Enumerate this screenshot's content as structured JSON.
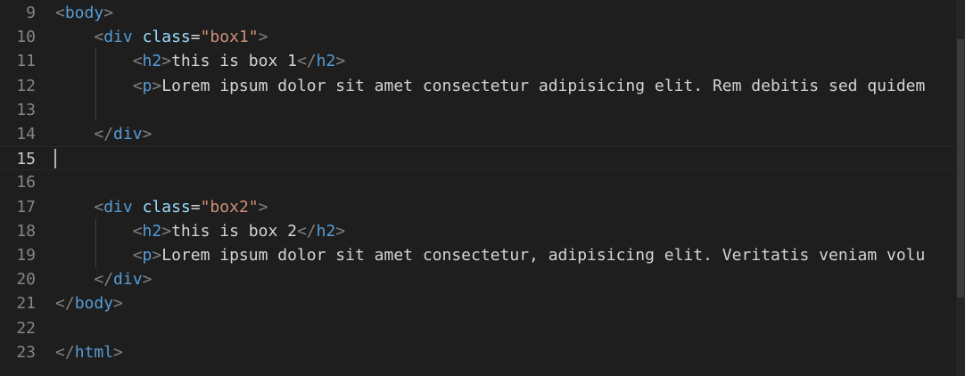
{
  "editor": {
    "lines": [
      {
        "num": "9",
        "indent": "",
        "tokens": [
          [
            "bracket",
            "<"
          ],
          [
            "tag",
            "body"
          ],
          [
            "bracket",
            ">"
          ]
        ]
      },
      {
        "num": "10",
        "indent": "    ",
        "tokens": [
          [
            "bracket",
            "<"
          ],
          [
            "tag",
            "div"
          ],
          [
            "text",
            " "
          ],
          [
            "attr",
            "class"
          ],
          [
            "text",
            "="
          ],
          [
            "str",
            "\"box1\""
          ],
          [
            "bracket",
            ">"
          ]
        ]
      },
      {
        "num": "11",
        "indent": "        ",
        "tokens": [
          [
            "bracket",
            "<"
          ],
          [
            "tag",
            "h2"
          ],
          [
            "bracket",
            ">"
          ],
          [
            "text",
            "this is box 1"
          ],
          [
            "bracket",
            "</"
          ],
          [
            "tag",
            "h2"
          ],
          [
            "bracket",
            ">"
          ]
        ]
      },
      {
        "num": "12",
        "indent": "        ",
        "tokens": [
          [
            "bracket",
            "<"
          ],
          [
            "tag",
            "p"
          ],
          [
            "bracket",
            ">"
          ],
          [
            "text",
            "Lorem ipsum dolor sit amet consectetur adipisicing elit. Rem debitis sed quidem"
          ]
        ]
      },
      {
        "num": "13",
        "indent": "",
        "tokens": []
      },
      {
        "num": "14",
        "indent": "    ",
        "tokens": [
          [
            "bracket",
            "</"
          ],
          [
            "tag",
            "div"
          ],
          [
            "bracket",
            ">"
          ]
        ]
      },
      {
        "num": "15",
        "indent": "",
        "tokens": []
      },
      {
        "num": "16",
        "indent": "",
        "tokens": []
      },
      {
        "num": "17",
        "indent": "    ",
        "tokens": [
          [
            "bracket",
            "<"
          ],
          [
            "tag",
            "div"
          ],
          [
            "text",
            " "
          ],
          [
            "attr",
            "class"
          ],
          [
            "text",
            "="
          ],
          [
            "str",
            "\"box2\""
          ],
          [
            "bracket",
            ">"
          ]
        ]
      },
      {
        "num": "18",
        "indent": "        ",
        "tokens": [
          [
            "bracket",
            "<"
          ],
          [
            "tag",
            "h2"
          ],
          [
            "bracket",
            ">"
          ],
          [
            "text",
            "this is box 2"
          ],
          [
            "bracket",
            "</"
          ],
          [
            "tag",
            "h2"
          ],
          [
            "bracket",
            ">"
          ]
        ]
      },
      {
        "num": "19",
        "indent": "        ",
        "tokens": [
          [
            "bracket",
            "<"
          ],
          [
            "tag",
            "p"
          ],
          [
            "bracket",
            ">"
          ],
          [
            "text",
            "Lorem ipsum dolor sit amet consectetur, adipisicing elit. Veritatis veniam volu"
          ]
        ]
      },
      {
        "num": "20",
        "indent": "    ",
        "tokens": [
          [
            "bracket",
            "</"
          ],
          [
            "tag",
            "div"
          ],
          [
            "bracket",
            ">"
          ]
        ]
      },
      {
        "num": "21",
        "indent": "",
        "tokens": [
          [
            "bracket",
            "</"
          ],
          [
            "tag",
            "body"
          ],
          [
            "bracket",
            ">"
          ]
        ]
      },
      {
        "num": "22",
        "indent": "",
        "tokens": []
      },
      {
        "num": "23",
        "indent": "",
        "tokens": [
          [
            "bracket",
            "</"
          ],
          [
            "tag",
            "html"
          ],
          [
            "bracket",
            ">"
          ]
        ]
      }
    ],
    "current_line": "15"
  }
}
